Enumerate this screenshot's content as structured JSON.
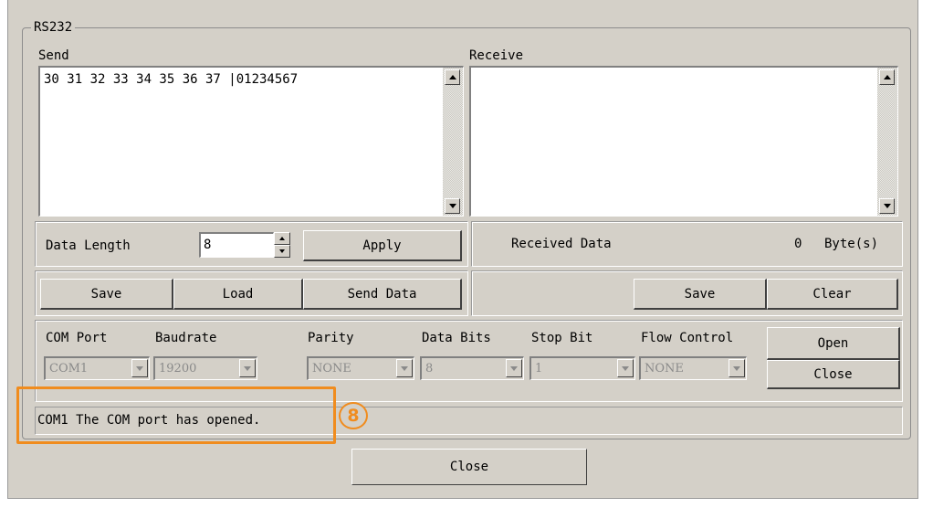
{
  "group_title": "RS232",
  "send": {
    "label": "Send",
    "content": "30 31 32 33 34 35 36 37 |01234567"
  },
  "receive": {
    "label": "Receive",
    "content": ""
  },
  "data_length": {
    "label": "Data Length",
    "value": "8",
    "apply_label": "Apply"
  },
  "received_data": {
    "label": "Received Data",
    "count": "0",
    "unit": "Byte(s)"
  },
  "send_buttons": {
    "save": "Save",
    "load": "Load",
    "send_data": "Send Data"
  },
  "receive_buttons": {
    "save": "Save",
    "clear": "Clear"
  },
  "settings": {
    "com_port": {
      "label": "COM Port",
      "value": "COM1"
    },
    "baudrate": {
      "label": "Baudrate",
      "value": "19200"
    },
    "parity": {
      "label": "Parity",
      "value": "NONE"
    },
    "data_bits": {
      "label": "Data Bits",
      "value": "8"
    },
    "stop_bit": {
      "label": "Stop Bit",
      "value": "1"
    },
    "flow_control": {
      "label": "Flow Control",
      "value": "NONE"
    },
    "open_label": "Open",
    "close_label": "Close"
  },
  "status": {
    "message": "COM1 The COM port has opened."
  },
  "annotation": {
    "badge": "8",
    "color": "#f08c1e"
  },
  "footer": {
    "close_label": "Close"
  }
}
